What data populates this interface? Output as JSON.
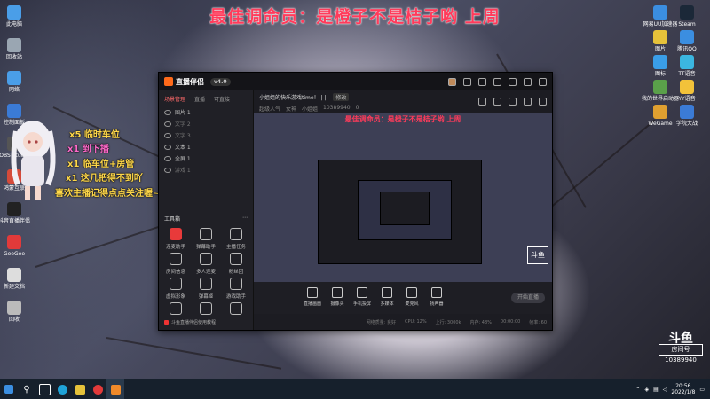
{
  "banner": "最佳调命员：是橙子不是桔子哟    上周",
  "desktop_left": [
    {
      "label": "此电脑",
      "color": "#4a9ee8"
    },
    {
      "label": "回收站",
      "color": "#9aa6b2"
    },
    {
      "label": "网络",
      "color": "#4a9ee8"
    },
    {
      "label": "控制面板",
      "color": "#3b7bd6"
    },
    {
      "label": "OBS Studio",
      "color": "#555"
    },
    {
      "label": "鸿蒙互联",
      "color": "#d54a3a"
    },
    {
      "label": "抖音直播伴侣",
      "color": "#222"
    },
    {
      "label": "GeeGee",
      "color": "#e23a3a"
    },
    {
      "label": "新建文档",
      "color": "#ddd"
    },
    {
      "label": "回收",
      "color": "#bbb"
    }
  ],
  "desktop_right": [
    {
      "label": "网易UU加速器",
      "color": "#3b8ee0"
    },
    {
      "label": "Steam",
      "color": "#1b2838"
    },
    {
      "label": "图片",
      "color": "#e6c23a"
    },
    {
      "label": "腾讯QQ",
      "color": "#3b8ee0"
    },
    {
      "label": "图标",
      "color": "#3a9ee8"
    },
    {
      "label": "TT语音",
      "color": "#3bb6e0"
    },
    {
      "label": "我的世界启动器",
      "color": "#5aa04a"
    },
    {
      "label": "YY语音",
      "color": "#f2c23a"
    },
    {
      "label": "WeGame",
      "color": "#e0a030"
    },
    {
      "label": "学院大战",
      "color": "#3b7bd6"
    }
  ],
  "overlay": {
    "messages": [
      {
        "text": "x5 临时车位",
        "color": "#ffd84a"
      },
      {
        "text": "x1 到下播",
        "color": "#ff6acb"
      },
      {
        "text": "x1 临车位+房管",
        "color": "#ffd84a"
      },
      {
        "text": "x1 这几把得不到吖",
        "color": "#ffd84a"
      },
      {
        "text": "喜欢主播记得点点关注喔~",
        "color": "#ffd84a"
      }
    ]
  },
  "app": {
    "name": "直播伴侣",
    "version": "v4.0",
    "left_tabs": [
      "场景管理",
      "直播",
      "可直接"
    ],
    "scenes": [
      {
        "label": "图片 1",
        "dim": false
      },
      {
        "label": "文字 2",
        "dim": true
      },
      {
        "label": "文字 3",
        "dim": true
      },
      {
        "label": "文本 1",
        "dim": false
      },
      {
        "label": "全屏 1",
        "dim": false
      },
      {
        "label": "游戏 1",
        "dim": true
      }
    ],
    "tools_header": "工具箱",
    "tools": [
      "连麦助手",
      "弹幕助手",
      "主播任务",
      "房间信息",
      "多人连麦",
      "粉丝团",
      "虚拟形象",
      "弹幕姬",
      "游戏助手",
      "",
      "",
      ""
    ],
    "bottom_note": "斗鱼直播伴侣使用教程",
    "room_title": "小姐姐的快乐游戏time！ | |",
    "room_tag": "修改",
    "room_meta": [
      "超级人气",
      "女神",
      "小姐姐",
      "10389940",
      "0"
    ],
    "preview_banner": "最佳调命员：是橙子不是桔子哟    上周",
    "preview_brand": "斗鱼",
    "controls": [
      "直播画面",
      "摄像头",
      "手机投屏",
      "多媒体",
      "麦克风",
      "扬声器"
    ],
    "start_label": "开始直播",
    "status": [
      "网络质量: 良好",
      "CPU: 12%",
      "上行: 3000k",
      "内存: 48%",
      "00:00:00",
      "帧率: 60"
    ]
  },
  "watermark": {
    "logo": "斗鱼",
    "label": "房间号",
    "room": "10389940"
  },
  "taskbar": {
    "time": "20:56",
    "date": "2022/1/8"
  }
}
